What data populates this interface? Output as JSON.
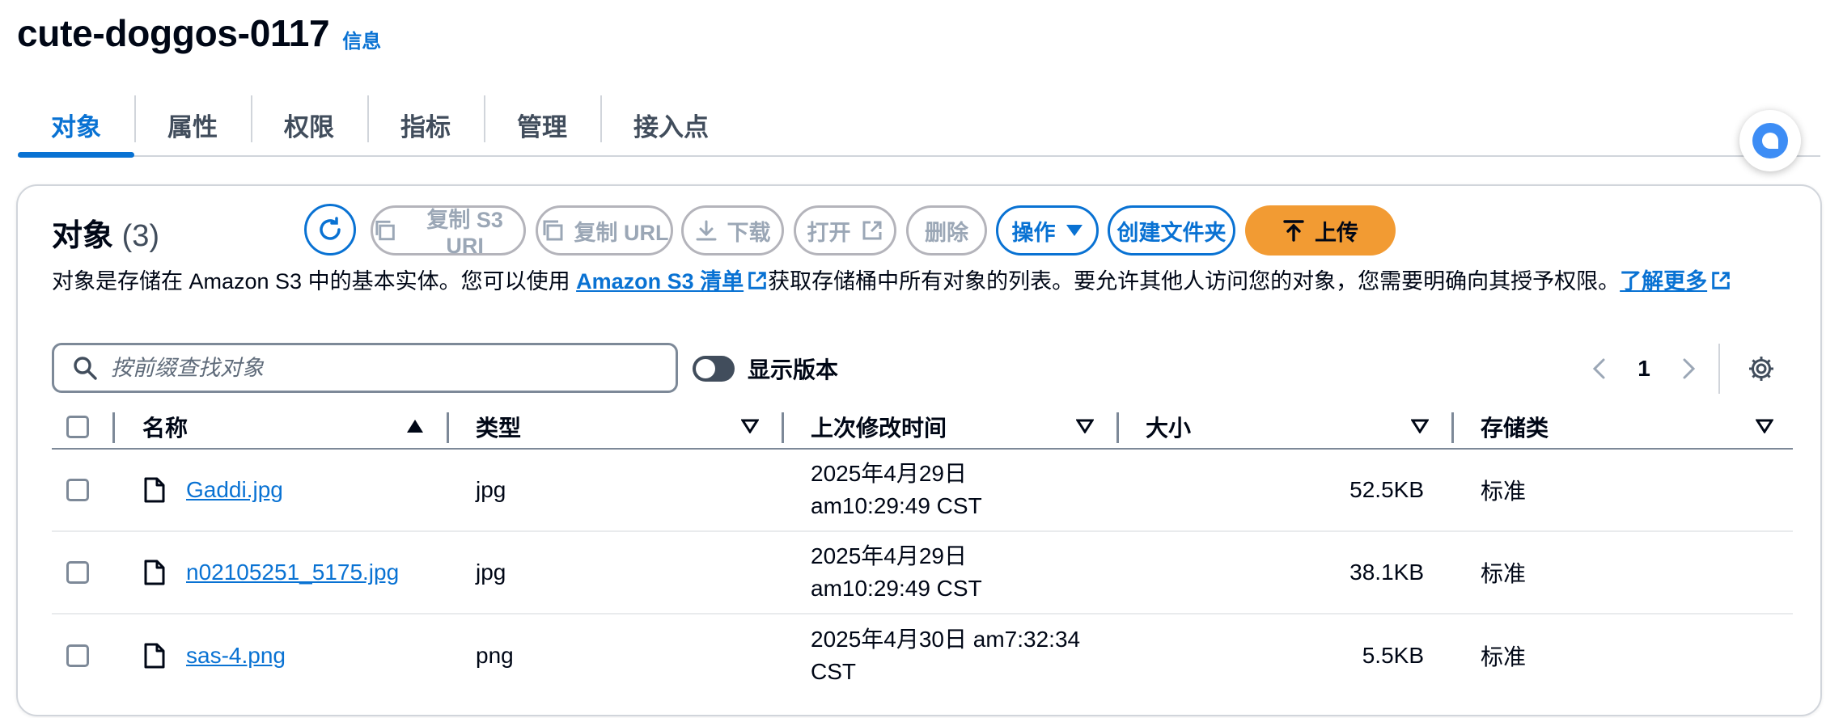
{
  "bucket": {
    "name": "cute-doggos-0117",
    "info_label": "信息"
  },
  "tabs": [
    {
      "label": "对象",
      "active": true
    },
    {
      "label": "属性"
    },
    {
      "label": "权限"
    },
    {
      "label": "指标"
    },
    {
      "label": "管理"
    },
    {
      "label": "接入点"
    }
  ],
  "objects_panel": {
    "title": "对象",
    "count": "(3)",
    "buttons": {
      "copy_s3_uri": "复制 S3 URI",
      "copy_url": "复制 URL",
      "download": "下载",
      "open": "打开",
      "delete": "删除",
      "actions": "操作",
      "create_folder": "创建文件夹",
      "upload": "上传"
    },
    "description": {
      "before_link": "对象是存储在 Amazon S3 中的基本实体。您可以使用 ",
      "inventory_link": "Amazon S3 清单",
      "after_link": "获取存储桶中所有对象的列表。要允许其他人访问您的对象，您需要明确向其授予权限。",
      "learn_more": "了解更多"
    },
    "search": {
      "placeholder": "按前缀查找对象",
      "value": ""
    },
    "show_versions_label": "显示版本",
    "show_versions_enabled": false,
    "pagination": {
      "current_page": "1"
    },
    "columns": {
      "name": "名称",
      "type": "类型",
      "last_modified": "上次修改时间",
      "size": "大小",
      "storage_class": "存储类"
    },
    "rows": [
      {
        "name": "Gaddi.jpg",
        "type": "jpg",
        "modified_line1": "2025年4月29日",
        "modified_line2": "am10:29:49 CST",
        "size": "52.5KB",
        "storage_class": "标准"
      },
      {
        "name": "n02105251_5175.jpg",
        "type": "jpg",
        "modified_line1": "2025年4月29日",
        "modified_line2": "am10:29:49 CST",
        "size": "38.1KB",
        "storage_class": "标准"
      },
      {
        "name": "sas-4.png",
        "type": "png",
        "modified_line1": "2025年4月30日 am7:32:34",
        "modified_line2": "CST",
        "size": "5.5KB",
        "storage_class": "标准"
      }
    ]
  },
  "colors": {
    "accent": "#0972d3",
    "upload_button": "#f29b33",
    "disabled": "#9ba7b6",
    "border": "#d1d5db"
  }
}
